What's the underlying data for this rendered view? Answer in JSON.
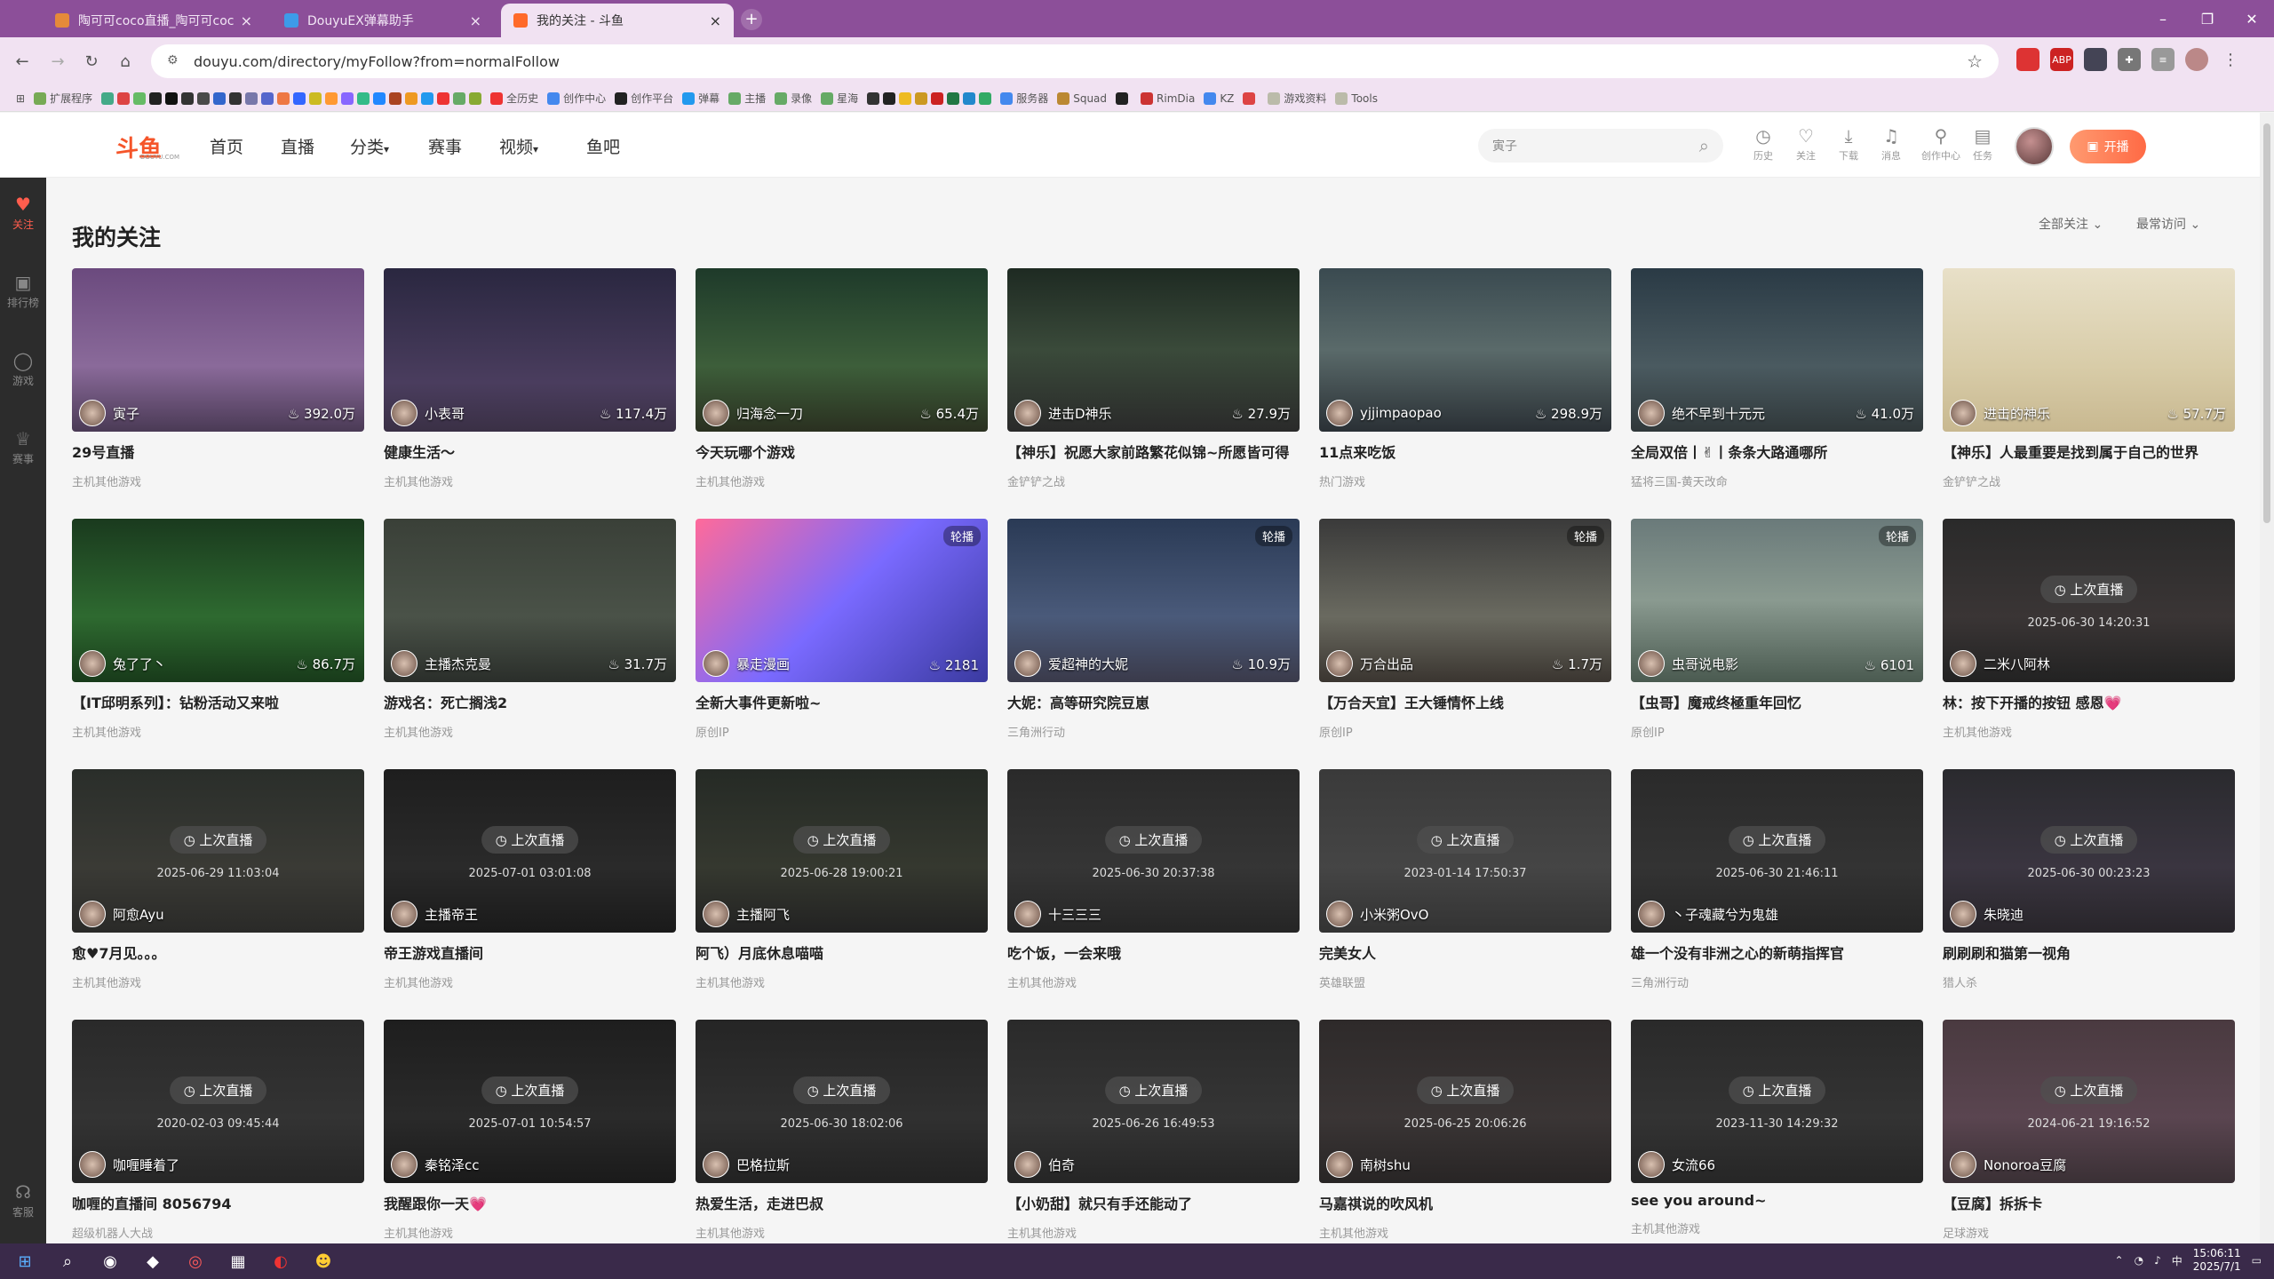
{
  "browser": {
    "tabs": [
      {
        "title": "陶可可coco直播_陶可可coco直播",
        "color": "#e58a3a"
      },
      {
        "title": "DouyuEX弹幕助手",
        "color": "#3d9be9"
      },
      {
        "title": "我的关注 - 斗鱼",
        "color": "#ff6a2a"
      }
    ],
    "new_tab": "+",
    "url": "douyu.com/directory/myFollow?from=normalFollow",
    "bookmarks": [
      "扩展程序",
      "全历史",
      "创作中心",
      "创作平台",
      "弹幕",
      "主播",
      "录像",
      "星海",
      "Squad",
      "RimDia",
      "KZ",
      "游戏资料",
      "Tools"
    ]
  },
  "header": {
    "logo_text": "斗鱼",
    "logo_sub": "DOUYU.COM",
    "nav": [
      "首页",
      "直播",
      "分类",
      "赛事",
      "视频",
      "鱼吧"
    ],
    "search_placeholder": "寅子",
    "icons": [
      {
        "name": "history",
        "label": "历史"
      },
      {
        "name": "follow",
        "label": "关注"
      },
      {
        "name": "download",
        "label": "下载"
      },
      {
        "name": "message",
        "label": "消息"
      },
      {
        "name": "creator",
        "label": "创作中心"
      },
      {
        "name": "task",
        "label": "任务"
      }
    ],
    "start_live": "开播"
  },
  "sidebar": [
    {
      "label": "关注",
      "icon": "heart-icon"
    },
    {
      "label": "排行榜",
      "icon": "rank-icon"
    },
    {
      "label": "游戏",
      "icon": "game-icon"
    },
    {
      "label": "赛事",
      "icon": "trophy-icon"
    },
    {
      "label": "客服",
      "icon": "headset-icon"
    }
  ],
  "page": {
    "title": "我的关注",
    "filter_all": "全部关注",
    "filter_sort": "最常访问"
  },
  "cards": [
    {
      "streamer": "寅子",
      "heat": "392.0万",
      "title": "29号直播",
      "category": "主机其他游戏",
      "live": true,
      "bg": "linear-gradient(180deg,#6b4a7e,#8a6a9a 60%,#4a3a55)"
    },
    {
      "streamer": "小表哥",
      "heat": "117.4万",
      "title": "健康生活～",
      "category": "主机其他游戏",
      "live": true,
      "bg": "linear-gradient(180deg,#2a2740,#4a3d5e 70%,#3a3045)"
    },
    {
      "streamer": "归海念一刀",
      "heat": "65.4万",
      "title": "今天玩哪个游戏",
      "category": "主机其他游戏",
      "live": true,
      "bg": "linear-gradient(180deg,#1e3a2a,#3d5e3a 60%,#2a3020)"
    },
    {
      "streamer": "进击D神乐",
      "heat": "27.9万",
      "title": "【神乐】祝愿大家前路繁花似锦~所愿皆可得",
      "category": "金铲铲之战",
      "live": true,
      "bg": "linear-gradient(180deg,#1e2a22,#3a4a3a 50%,#2a2a2a)"
    },
    {
      "streamer": "yjjimpaopao",
      "heat": "298.9万",
      "title": "11点来吃饭",
      "category": "热门游戏",
      "live": true,
      "bg": "linear-gradient(180deg,#3a4a50,#5a6a6a 50%,#2a3035)"
    },
    {
      "streamer": "绝不早到十元元",
      "heat": "41.0万",
      "title": "全局双倍丨✌丨条条大路通哪所",
      "category": "猛将三国-黄天改命",
      "live": true,
      "bg": "linear-gradient(180deg,#2a3a45,#4a5a60 60%,#30383a)"
    },
    {
      "streamer": "进击的神乐",
      "heat": "57.7万",
      "title": "【神乐】人最重要是找到属于自己的世界",
      "category": "金铲铲之战",
      "live": true,
      "bg": "linear-gradient(180deg,#e8e0c8,#d8cca8 60%,#c8b890)"
    },
    {
      "streamer": "兔了了丶",
      "heat": "86.7万",
      "title": "【IT邱明系列】：钻粉活动又来啦",
      "category": "主机其他游戏",
      "live": true,
      "bg": "linear-gradient(180deg,#1a3a1e,#2e6a30 60%,#183a1a)"
    },
    {
      "streamer": "主播杰克曼",
      "heat": "31.7万",
      "title": "游戏名：死亡搁浅2",
      "category": "主机其他游戏",
      "live": true,
      "bg": "linear-gradient(180deg,#3a4038,#4a5248 60%,#2a2e2a)"
    },
    {
      "streamer": "暴走漫画",
      "heat": "2181",
      "title": "全新大事件更新啦~",
      "category": "原创IP",
      "live": true,
      "rotate": "轮播",
      "bg": "linear-gradient(135deg,#ff6a9a,#7a6aff 50%,#3a3aa0)"
    },
    {
      "streamer": "爱超神的大妮",
      "heat": "10.9万",
      "title": "大妮：高等研究院豆崽",
      "category": "三角洲行动",
      "live": true,
      "rotate": "轮播",
      "bg": "linear-gradient(180deg,#2a3a55,#4a5a7a 60%,#3a3a4a)"
    },
    {
      "streamer": "万合出品",
      "heat": "1.7万",
      "title": "【万合天宜】王大锤情怀上线",
      "category": "原创IP",
      "live": true,
      "rotate": "轮播",
      "bg": "linear-gradient(180deg,#3a3a3a,#6a6a60 60%,#3a3530)"
    },
    {
      "streamer": "虫哥说电影",
      "heat": "6101",
      "title": "【虫哥】魔戒终極重年回忆",
      "category": "原创IP",
      "live": true,
      "rotate": "轮播",
      "bg": "linear-gradient(180deg,#6a7a7a,#8a9a90 50%,#4a5a50)"
    },
    {
      "streamer": "二米八阿林",
      "title": "林：按下开播的按钮 感恩💗",
      "category": "主机其他游戏",
      "live": false,
      "last_label": "上次直播",
      "last_time": "2025-06-30 14:20:31",
      "bg": "linear-gradient(180deg,#2a2a2a,#3a3535 60%,#222)"
    },
    {
      "streamer": "阿愈Ayu",
      "title": "愈♥7月见。。。",
      "category": "主机其他游戏",
      "live": false,
      "last_label": "上次直播",
      "last_time": "2025-06-29 11:03:04",
      "bg": "linear-gradient(180deg,#2a2e2a,#3a3a35 60%,#2a2a28)"
    },
    {
      "streamer": "主播帝王",
      "title": "帝王游戏直播间",
      "category": "主机其他游戏",
      "live": false,
      "last_label": "上次直播",
      "last_time": "2025-07-01 03:01:08",
      "bg": "linear-gradient(180deg,#1e1e1e,#2a2a2a 60%,#1a1a1a)"
    },
    {
      "streamer": "主播阿飞",
      "title": "阿飞）月底休息喵喵",
      "category": "主机其他游戏",
      "live": false,
      "last_label": "上次直播",
      "last_time": "2025-06-28 19:00:21",
      "bg": "linear-gradient(180deg,#252a25,#35382f 60%,#222)"
    },
    {
      "streamer": "十三三三",
      "title": "吃个饭，一会来哦",
      "category": "主机其他游戏",
      "live": false,
      "last_label": "上次直播",
      "last_time": "2025-06-30 20:37:38",
      "bg": "linear-gradient(180deg,#2a2a2a,#353535 60%,#252525)"
    },
    {
      "streamer": "小米粥OvO",
      "title": "完美女人",
      "category": "英雄联盟",
      "live": false,
      "last_label": "上次直播",
      "last_time": "2023-01-14 17:50:37",
      "bg": "linear-gradient(180deg,#3a3a3a,#454545 60%,#333)"
    },
    {
      "streamer": "丶子魂藏兮为鬼雄",
      "title": "雄一个没有非洲之心的新萌指挥官",
      "category": "三角洲行动",
      "live": false,
      "last_label": "上次直播",
      "last_time": "2025-06-30 21:46:11",
      "bg": "linear-gradient(180deg,#2a2a2a,#333 60%,#262626)"
    },
    {
      "streamer": "朱晓迪",
      "title": "刷刷刷和猫第一视角",
      "category": "猎人杀",
      "live": false,
      "last_label": "上次直播",
      "last_time": "2025-06-30 00:23:23",
      "bg": "linear-gradient(180deg,#2a2a2e,#3a3540 60%,#28252a)"
    },
    {
      "streamer": "咖喱睡着了",
      "title": "咖喱的直播间 8056794",
      "category": "超级机器人大战",
      "live": false,
      "last_label": "上次直播",
      "last_time": "2020-02-03 09:45:44",
      "bg": "linear-gradient(180deg,#2a2a2a,#333 60%,#262626)"
    },
    {
      "streamer": "秦铭泽cc",
      "title": "我醒跟你一天💗",
      "category": "主机其他游戏",
      "live": false,
      "last_label": "上次直播",
      "last_time": "2025-07-01 10:54:57",
      "bg": "linear-gradient(180deg,#1e1e1e,#2a2a2a 60%,#1a1a1a)"
    },
    {
      "streamer": "巴格拉斯",
      "title": "热爱生活，走进巴叔",
      "category": "主机其他游戏",
      "live": false,
      "last_label": "上次直播",
      "last_time": "2025-06-30 18:02:06",
      "bg": "linear-gradient(180deg,#252525,#303030 60%,#222)"
    },
    {
      "streamer": "伯奇",
      "title": "【小奶甜】就只有手还能动了",
      "category": "主机其他游戏",
      "live": false,
      "last_label": "上次直播",
      "last_time": "2025-06-26 16:49:53",
      "bg": "linear-gradient(180deg,#2a2a2a,#353535 60%,#252525)"
    },
    {
      "streamer": "南树shu",
      "title": "马嘉祺说的吹风机",
      "category": "主机其他游戏",
      "live": false,
      "last_label": "上次直播",
      "last_time": "2025-06-25 20:06:26",
      "bg": "linear-gradient(180deg,#2e2a2a,#3a3535 60%,#282525)"
    },
    {
      "streamer": "女流66",
      "title": "see you around~",
      "category": "主机其他游戏",
      "live": false,
      "last_label": "上次直播",
      "last_time": "2023-11-30 14:29:32",
      "bg": "linear-gradient(180deg,#2a2a2a,#333 60%,#262626)"
    },
    {
      "streamer": "Nonoroa豆腐",
      "title": "【豆腐】拆拆卡",
      "category": "足球游戏",
      "live": false,
      "last_label": "上次直播",
      "last_time": "2024-06-21 19:16:52",
      "bg": "linear-gradient(180deg,#4a3a40,#5a4550 60%,#3a3035)"
    }
  ],
  "taskbar": {
    "time": "15:06:11",
    "date": "2025/7/1"
  }
}
